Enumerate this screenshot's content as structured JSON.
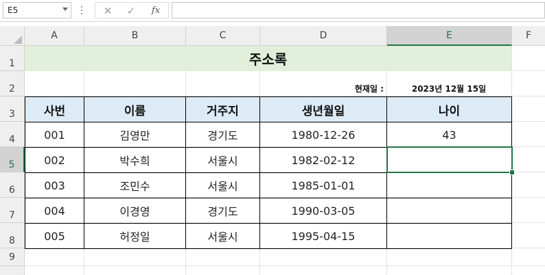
{
  "formula_bar": {
    "name_box": "E5",
    "cancel_icon": "✕",
    "enter_icon": "✓",
    "fx_label": "fx",
    "formula_value": ""
  },
  "columns": [
    "A",
    "B",
    "C",
    "D",
    "E",
    "F"
  ],
  "rows": [
    "1",
    "2",
    "3",
    "4",
    "5",
    "6",
    "7",
    "8",
    "9"
  ],
  "selected_cell": "E5",
  "sheet": {
    "title": "주소록",
    "date_label": "현재일 :",
    "date_value": "2023년 12월 15일",
    "headers": [
      "사번",
      "이름",
      "거주지",
      "생년월일",
      "나이"
    ],
    "records": [
      {
        "id": "001",
        "name": "김영만",
        "residence": "경기도",
        "birth": "1980-12-26",
        "age": "43"
      },
      {
        "id": "002",
        "name": "박수희",
        "residence": "서울시",
        "birth": "1982-02-12",
        "age": ""
      },
      {
        "id": "003",
        "name": "조민수",
        "residence": "서울시",
        "birth": "1985-01-01",
        "age": ""
      },
      {
        "id": "004",
        "name": "이경영",
        "residence": "경기도",
        "birth": "1990-03-05",
        "age": ""
      },
      {
        "id": "005",
        "name": "허정일",
        "residence": "서울시",
        "birth": "1995-04-15",
        "age": ""
      }
    ]
  },
  "colors": {
    "title_band": "#e2efda",
    "header_fill": "#ddebf7",
    "selection": "#217346"
  }
}
